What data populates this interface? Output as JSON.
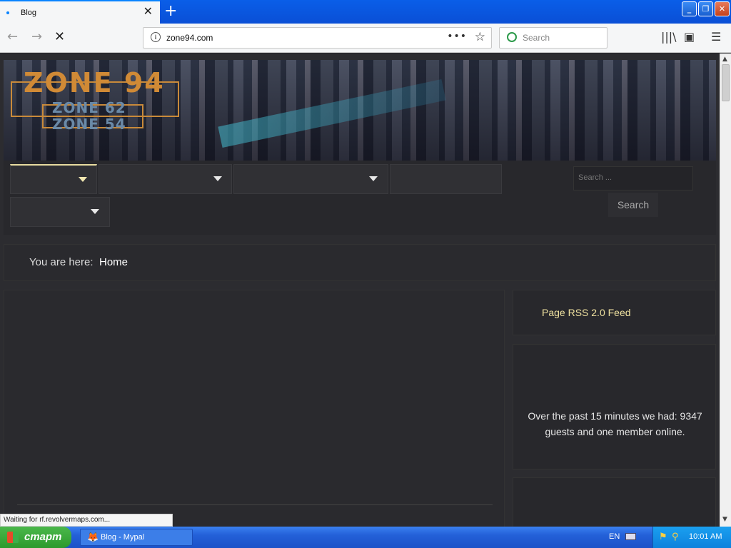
{
  "browser": {
    "tab_title": "Blog",
    "tab_close": "✕",
    "new_tab": "+",
    "url": "zone94.com",
    "page_actions": "•••",
    "bookmark_star": "☆",
    "search_placeholder": "Search",
    "window_buttons": {
      "minimize": "_",
      "maximize": "❐",
      "close": "✕"
    },
    "nav_icons": {
      "back": "←",
      "forward": "→",
      "stop": "✕"
    },
    "toolbar_icons": {
      "library": "|||\\",
      "sidebar": "▣",
      "menu": "☰"
    },
    "status_text": "Waiting for rf.revolvermaps.com..."
  },
  "site": {
    "logo_main": "ZONE 94",
    "logo_sub_1": "ZONE 62",
    "logo_sub_2": "ZONE 54",
    "search_placeholder": "Search ...",
    "search_button": "Search",
    "breadcrumb_label": "You are here:",
    "breadcrumb_current": "Home",
    "rss_link": "Page RSS 2.0 Feed",
    "stats_text": "Over the past 15 minutes we had: 9347 guests and one member online."
  },
  "taskbar": {
    "start_label": "старт",
    "task_label": "Blog - Mypal",
    "language": "EN",
    "clock": "10:01 AM"
  },
  "colors": {
    "titlebar": "#0a5ee8",
    "page_bg": "#2c2c30",
    "accent_gold": "#f0e2a0",
    "logo_orange": "#d08a36",
    "taskbar": "#2360d8",
    "start_green": "#3ab04a"
  }
}
